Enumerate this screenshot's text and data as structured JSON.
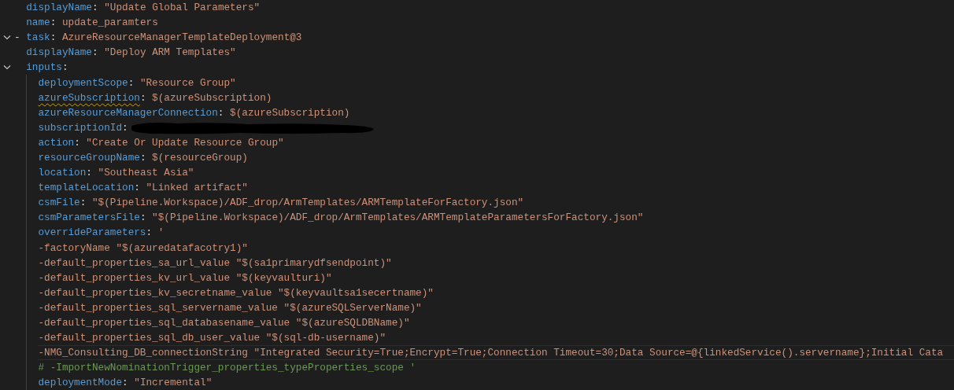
{
  "editor": {
    "lines": [
      {
        "kind": "plain",
        "tokens": [
          {
            "kind": "key",
            "text": "displayName"
          },
          {
            "kind": "punct",
            "text": ":"
          },
          {
            "kind": "string",
            "text": "\"Update Global Parameters\""
          }
        ]
      },
      {
        "kind": "plain",
        "tokens": [
          {
            "kind": "key",
            "text": "name"
          },
          {
            "kind": "punct",
            "text": ":"
          },
          {
            "kind": "string",
            "text": "update_paramters"
          }
        ]
      },
      {
        "kind": "fold",
        "expanded": true,
        "tokens": [
          {
            "kind": "dash",
            "text": "-"
          },
          {
            "kind": "key",
            "text": "task"
          },
          {
            "kind": "punct",
            "text": ":"
          },
          {
            "kind": "string",
            "text": "AzureResourceManagerTemplateDeployment@3"
          }
        ]
      },
      {
        "kind": "plain",
        "tokens": [
          {
            "kind": "key",
            "text": "displayName"
          },
          {
            "kind": "punct",
            "text": ":"
          },
          {
            "kind": "string",
            "text": "\"Deploy ARM Templates\""
          }
        ]
      },
      {
        "kind": "fold",
        "expanded": true,
        "tokens": [
          {
            "kind": "key",
            "text": "inputs"
          },
          {
            "kind": "punct",
            "text": ":"
          }
        ],
        "children": [
          {
            "kind": "plain",
            "tokens": [
              {
                "kind": "key",
                "text": "deploymentScope"
              },
              {
                "kind": "punct",
                "text": ":"
              },
              {
                "kind": "string",
                "text": "\"Resource Group\""
              }
            ]
          },
          {
            "kind": "plain",
            "tokens": [
              {
                "kind": "key_warning",
                "text": "azureSubscription"
              },
              {
                "kind": "punct",
                "text": ":"
              },
              {
                "kind": "string",
                "text": "$(azureSubscription)"
              }
            ]
          },
          {
            "kind": "plain",
            "tokens": [
              {
                "kind": "key",
                "text": "azureResourceManagerConnection"
              },
              {
                "kind": "punct",
                "text": ":"
              },
              {
                "kind": "string",
                "text": "$(azureSubscription)"
              }
            ]
          },
          {
            "kind": "plain",
            "tokens": [
              {
                "kind": "key",
                "text": "subscriptionId"
              },
              {
                "kind": "punct",
                "text": ":"
              },
              {
                "kind": "redacted"
              }
            ]
          },
          {
            "kind": "plain",
            "tokens": [
              {
                "kind": "key",
                "text": "action"
              },
              {
                "kind": "punct",
                "text": ":"
              },
              {
                "kind": "string",
                "text": "\"Create Or Update Resource Group\""
              }
            ]
          },
          {
            "kind": "plain",
            "tokens": [
              {
                "kind": "key",
                "text": "resourceGroupName"
              },
              {
                "kind": "punct",
                "text": ":"
              },
              {
                "kind": "string",
                "text": "$(resourceGroup)"
              }
            ]
          },
          {
            "kind": "plain",
            "tokens": [
              {
                "kind": "key",
                "text": "location"
              },
              {
                "kind": "punct",
                "text": ":"
              },
              {
                "kind": "string",
                "text": "\"Southeast Asia\""
              }
            ]
          },
          {
            "kind": "plain",
            "tokens": [
              {
                "kind": "key",
                "text": "templateLocation"
              },
              {
                "kind": "punct",
                "text": ":"
              },
              {
                "kind": "string",
                "text": "\"Linked artifact\""
              }
            ]
          },
          {
            "kind": "plain",
            "tokens": [
              {
                "kind": "key",
                "text": "csmFile"
              },
              {
                "kind": "punct",
                "text": ":"
              },
              {
                "kind": "string",
                "text": "\"$(Pipeline.Workspace)/ADF_drop/ArmTemplates/ARMTemplateForFactory.json\""
              }
            ]
          },
          {
            "kind": "plain",
            "tokens": [
              {
                "kind": "key",
                "text": "csmParametersFile"
              },
              {
                "kind": "punct",
                "text": ":"
              },
              {
                "kind": "string",
                "text": "\"$(Pipeline.Workspace)/ADF_drop/ArmTemplates/ARMTemplateParametersForFactory.json\""
              }
            ]
          },
          {
            "kind": "plain",
            "tokens": [
              {
                "kind": "key",
                "text": "overrideParameters"
              },
              {
                "kind": "punct",
                "text": ":"
              },
              {
                "kind": "string",
                "text": "'"
              }
            ]
          },
          {
            "kind": "plain",
            "tokens": [
              {
                "kind": "string",
                "text": "-factoryName \"$(azuredatafacotry1)\""
              }
            ]
          },
          {
            "kind": "plain",
            "tokens": [
              {
                "kind": "string",
                "text": "-default_properties_sa_url_value \"$(sa1primarydfsendpoint)\""
              }
            ]
          },
          {
            "kind": "plain",
            "tokens": [
              {
                "kind": "string",
                "text": "-default_properties_kv_url_value \"$(keyvaulturi)\""
              }
            ]
          },
          {
            "kind": "plain",
            "tokens": [
              {
                "kind": "string",
                "text": "-default_properties_kv_secretname_value \"$(keyvaultsa1secertname)\""
              }
            ]
          },
          {
            "kind": "plain",
            "tokens": [
              {
                "kind": "string",
                "text": "-default_properties_sql_servername_value \"$(azureSQLServerName)\""
              }
            ]
          },
          {
            "kind": "plain",
            "tokens": [
              {
                "kind": "string",
                "text": "-default_properties_sql_databasename_value \"$(azureSQLDBName)\""
              }
            ]
          },
          {
            "kind": "plain",
            "tokens": [
              {
                "kind": "string",
                "text": "-default_properties_sql_db_user_value \"$(sql-db-username)\""
              }
            ]
          },
          {
            "kind": "current",
            "tokens": [
              {
                "kind": "string",
                "text": "-NMG_Consulting_DB_connectionString \"Integrated Security=True;Encrypt=True;Connection Timeout=30;Data Source=@{linkedService().servername};Initial Cata"
              }
            ]
          },
          {
            "kind": "plain",
            "tokens": [
              {
                "kind": "comment",
                "text": "# -ImportNewNominationTrigger_properties_typeProperties_scope '"
              }
            ]
          },
          {
            "kind": "plain",
            "tokens": [
              {
                "kind": "key",
                "text": "deploymentMode"
              },
              {
                "kind": "punct",
                "text": ":"
              },
              {
                "kind": "string",
                "text": "\"Incremental\""
              }
            ]
          }
        ]
      }
    ]
  }
}
